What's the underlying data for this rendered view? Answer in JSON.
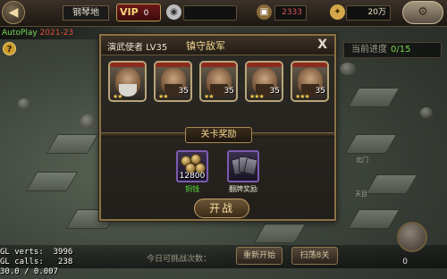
{
  "topbar": {
    "back_icon": "back-arrow-icon",
    "player_name": "钢琴地",
    "vip_label": "VIP",
    "vip_level": "0",
    "resource_1": "",
    "resource_2": "2333",
    "resource_3": "20万",
    "settings_icon": "gear-icon"
  },
  "subtitle": {
    "left": "AutoPlay",
    "right": "2021-23"
  },
  "progress": {
    "label": "当前进度",
    "value": "0/15"
  },
  "dialog": {
    "enemy_label": "演武使者 LV35",
    "title": "镇守敌军",
    "close_label": "X",
    "heroes": [
      {
        "level": "",
        "stars": "★★"
      },
      {
        "level": "35",
        "stars": "★★"
      },
      {
        "level": "35",
        "stars": "★★"
      },
      {
        "level": "35",
        "stars": "★★★"
      },
      {
        "level": "35",
        "stars": "★★★"
      }
    ],
    "reward_banner": "关卡奖励",
    "rewards": [
      {
        "name": "铜钱",
        "count": "12800",
        "color": "#5bdc3c"
      },
      {
        "name": "翻牌奖励",
        "count": "",
        "color": "#eae4d2"
      }
    ],
    "start_label": "开战"
  },
  "bottom": {
    "challenge_text": "今日可挑战次数：",
    "restart_label": "重新开始",
    "sweep_label": "扫荡8关",
    "count": "0"
  },
  "debug": {
    "line1": "GL verts:  3996",
    "line2": "GL calls:   238",
    "line3": "30.0 / 0.007"
  },
  "map_labels": {
    "a": "天目",
    "b": "北门"
  }
}
